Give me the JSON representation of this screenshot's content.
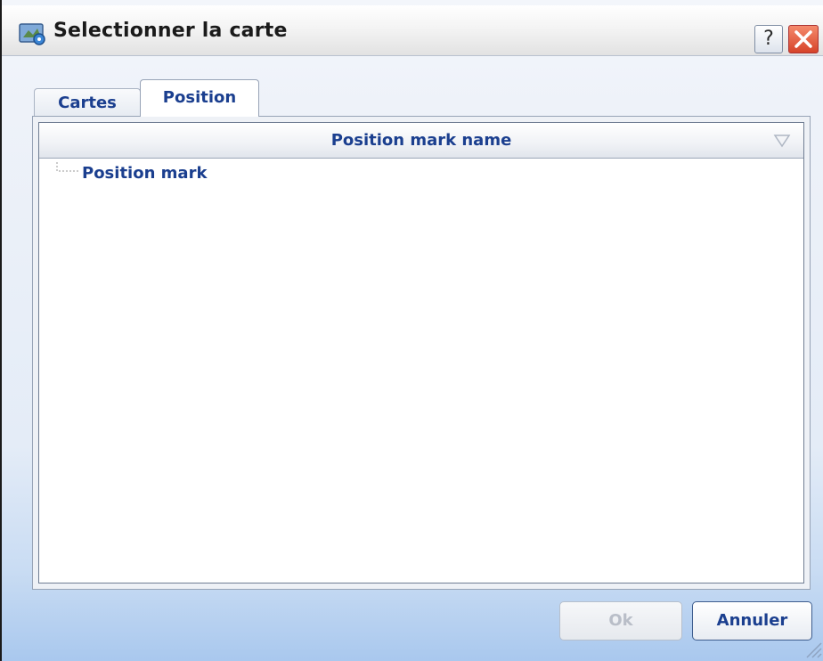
{
  "window": {
    "title": "Selectionner la carte",
    "help_label": "?",
    "icons": {
      "app": "map-app-icon",
      "help": "help-icon",
      "close": "close-icon"
    },
    "colors": {
      "close": "#d6432a",
      "accent_text": "#1b3f8f"
    }
  },
  "tabs": [
    {
      "label": "Cartes",
      "active": false
    },
    {
      "label": "Position",
      "active": true
    }
  ],
  "list": {
    "column_header": "Position mark name",
    "sort_icon": "sort-triangle-icon",
    "items": [
      {
        "label": "Position mark"
      }
    ]
  },
  "buttons": {
    "ok_label": "Ok",
    "ok_enabled": false,
    "cancel_label": "Annuler"
  }
}
